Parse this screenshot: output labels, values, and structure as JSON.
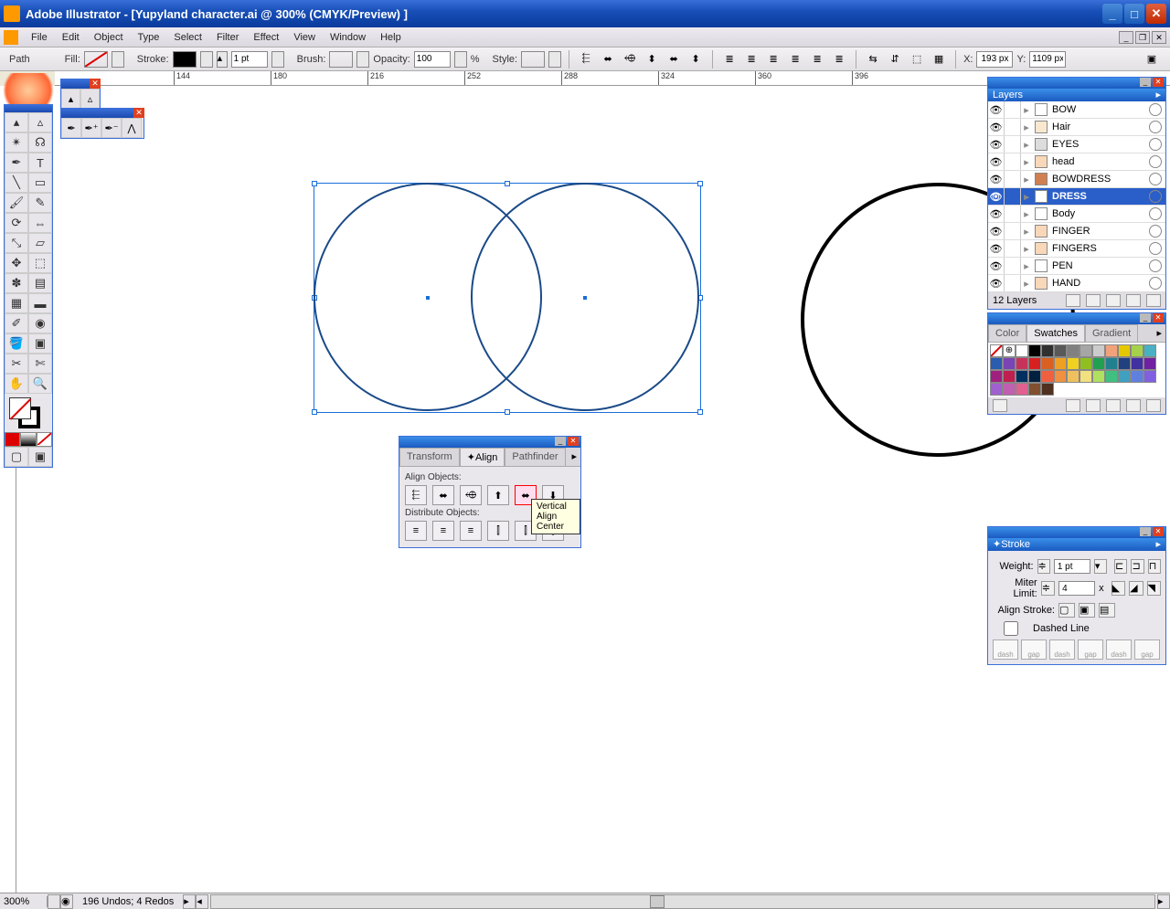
{
  "title": "Adobe Illustrator - [Yupyland character.ai @ 300% (CMYK/Preview) ]",
  "menu": [
    "File",
    "Edit",
    "Object",
    "Type",
    "Select",
    "Filter",
    "Effect",
    "View",
    "Window",
    "Help"
  ],
  "ctrl": {
    "selection": "Path",
    "fill_lbl": "Fill:",
    "stroke_lbl": "Stroke:",
    "stroke_wt": "1 pt",
    "brush_lbl": "Brush:",
    "opacity_lbl": "Opacity:",
    "opacity_val": "100",
    "pct": "%",
    "style_lbl": "Style:",
    "x_lbl": "X:",
    "x_val": "193 px",
    "y_lbl": "Y:",
    "y_val": "1109 px"
  },
  "ruler_ticks": [
    144,
    180,
    216,
    252,
    288,
    324,
    360,
    396
  ],
  "align": {
    "tabs": [
      "Transform",
      "Align",
      "Pathfinder"
    ],
    "active": 1,
    "sec1": "Align Objects:",
    "sec2": "Distribute Objects:",
    "tooltip": "Vertical Align Center"
  },
  "layers": {
    "title": "Layers",
    "items": [
      {
        "name": "BOW",
        "color": "#fff"
      },
      {
        "name": "Hair",
        "color": "#f8e8d0"
      },
      {
        "name": "EYES",
        "color": "#ddd"
      },
      {
        "name": "head",
        "color": "#f8d8b8"
      },
      {
        "name": "BOWDRESS",
        "color": "#d08050"
      },
      {
        "name": "DRESS",
        "color": "#fff",
        "selected": true
      },
      {
        "name": "Body",
        "color": "#fff"
      },
      {
        "name": "FINGER",
        "color": "#f8d8b8"
      },
      {
        "name": "FINGERS",
        "color": "#f8d8b8"
      },
      {
        "name": "PEN",
        "color": "#fff"
      },
      {
        "name": "HAND",
        "color": "#f8d8b8"
      }
    ],
    "count": "12 Layers"
  },
  "swatches": {
    "tabs": [
      "Color",
      "Swatches",
      "Gradient"
    ],
    "active": 1,
    "colors": [
      "#ffffff",
      "#000000",
      "#303030",
      "#595959",
      "#808080",
      "#a6a6a6",
      "#cccccc",
      "#f2a27a",
      "#e6c800",
      "#a5d24a",
      "#4ab0c4",
      "#2a5cb0",
      "#7a44b4",
      "#c8325a",
      "#d92020",
      "#d96020",
      "#f0a020",
      "#f0d020",
      "#90c020",
      "#20a050",
      "#208090",
      "#204080",
      "#4030a0",
      "#7020a0",
      "#a02080",
      "#c02050",
      "#003060",
      "#002040",
      "#f06040",
      "#f09040",
      "#f0c060",
      "#f0e080",
      "#b0e060",
      "#40c080",
      "#40a0c0",
      "#6080e0",
      "#8060e0",
      "#a060d0",
      "#c060b0",
      "#e06090",
      "#805030",
      "#503020"
    ]
  },
  "stroke": {
    "title": "Stroke",
    "weight_lbl": "Weight:",
    "weight_val": "1 pt",
    "miter_lbl": "Miter Limit:",
    "miter_val": "4",
    "x": "x",
    "align_lbl": "Align Stroke:",
    "dashed": "Dashed Line",
    "dash_labels": [
      "dash",
      "gap",
      "dash",
      "gap",
      "dash",
      "gap"
    ]
  },
  "status": {
    "zoom": "300%",
    "msg": "196 Undos; 4 Redos"
  }
}
